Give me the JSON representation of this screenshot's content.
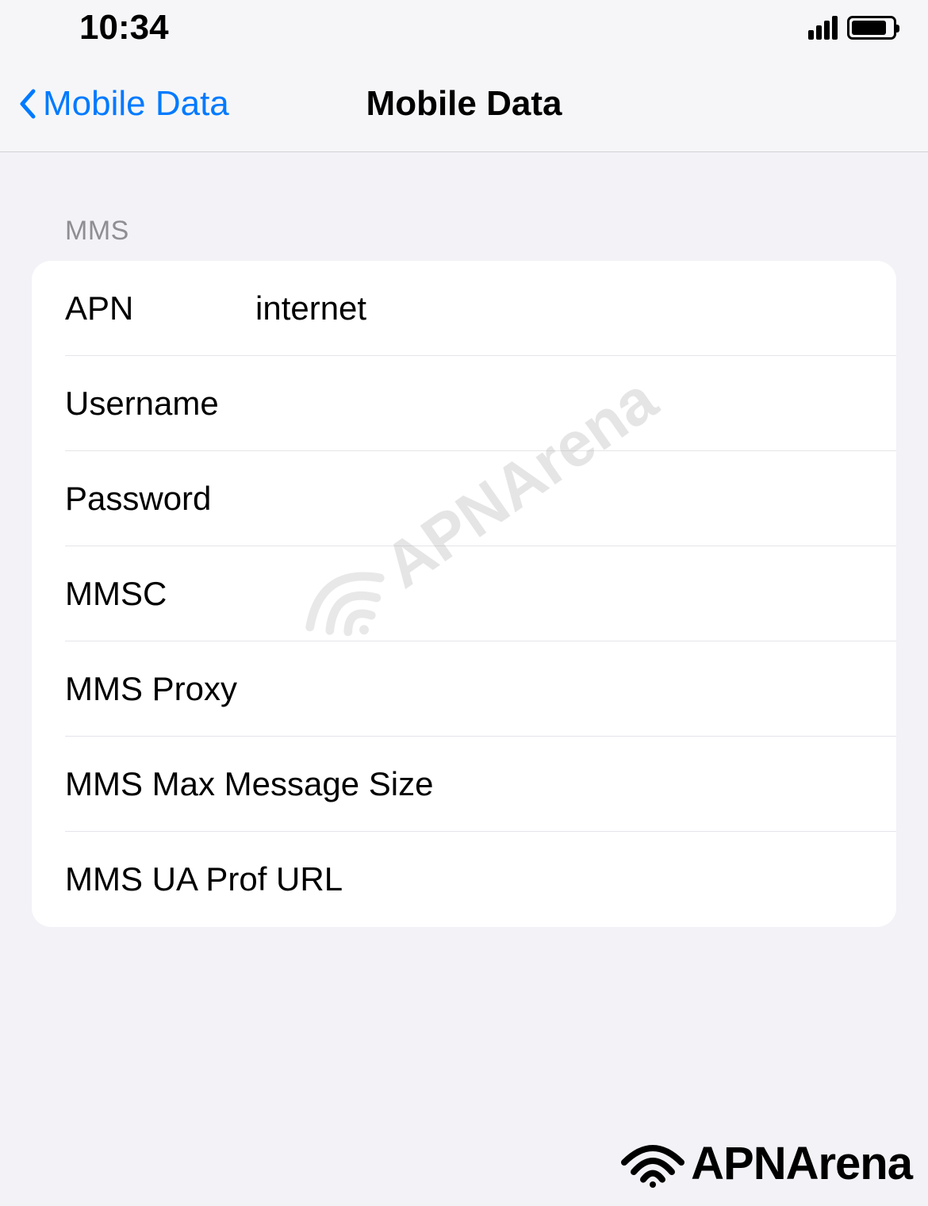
{
  "status_bar": {
    "time": "10:34"
  },
  "nav": {
    "back_label": "Mobile Data",
    "title": "Mobile Data"
  },
  "section": {
    "header": "MMS",
    "rows": [
      {
        "label": "APN",
        "value": "internet"
      },
      {
        "label": "Username",
        "value": ""
      },
      {
        "label": "Password",
        "value": ""
      },
      {
        "label": "MMSC",
        "value": ""
      },
      {
        "label": "MMS Proxy",
        "value": ""
      },
      {
        "label": "MMS Max Message Size",
        "value": ""
      },
      {
        "label": "MMS UA Prof URL",
        "value": ""
      }
    ]
  },
  "watermark": {
    "text": "APNArena"
  },
  "logo": {
    "text": "APNArena"
  }
}
